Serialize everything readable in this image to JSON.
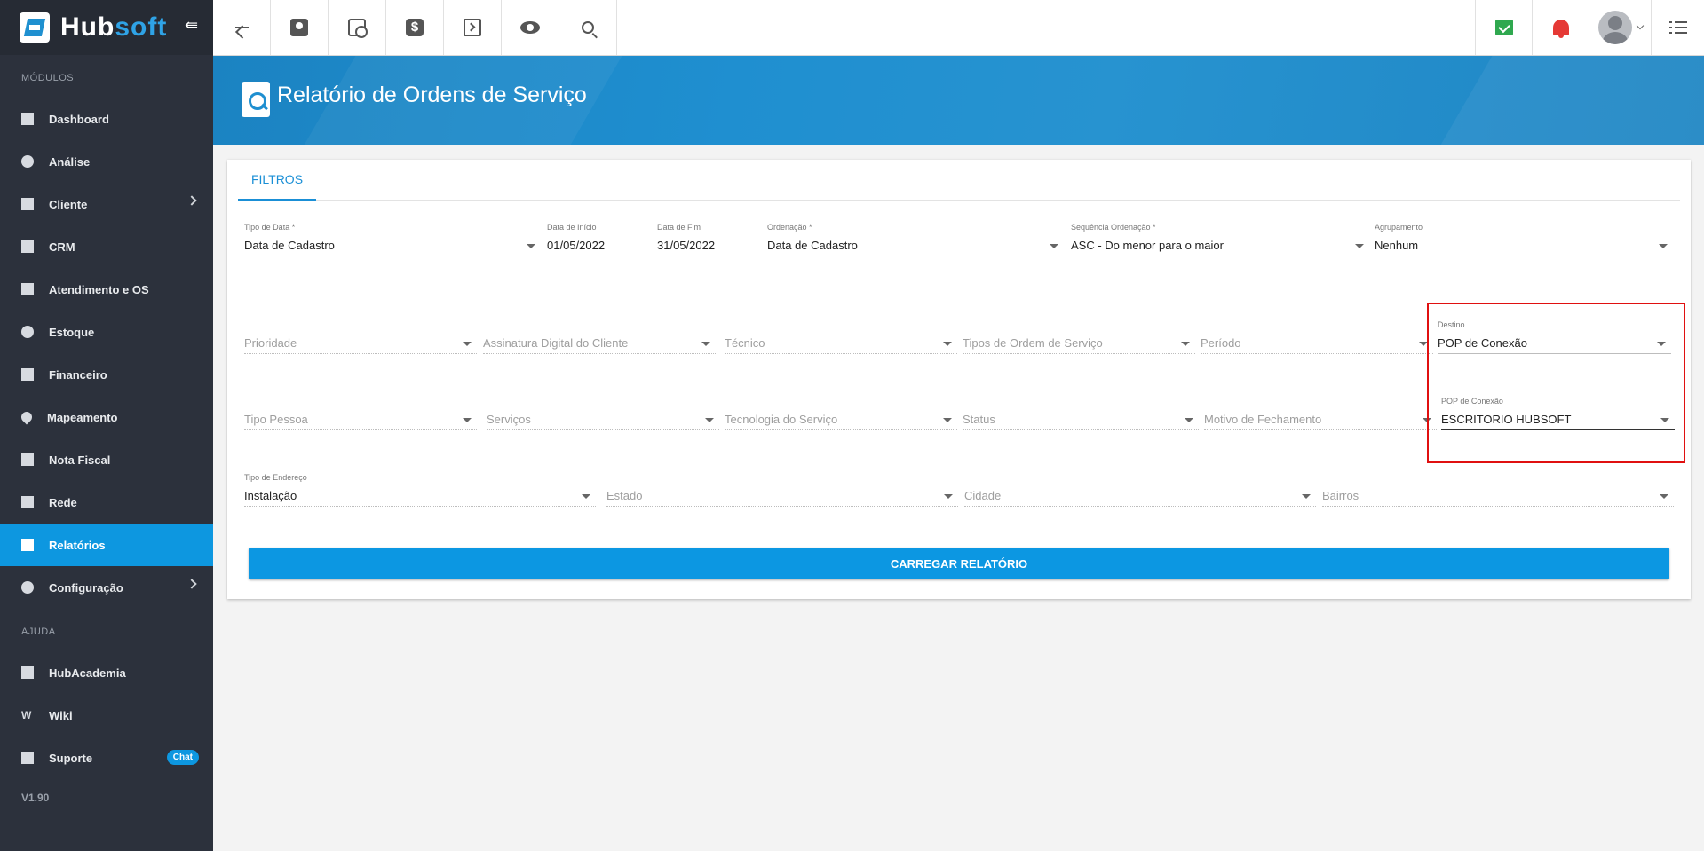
{
  "brand": {
    "part1": "Hub",
    "part2": "soft"
  },
  "sidebar": {
    "modules_label": "MÓDULOS",
    "items": [
      {
        "label": "Dashboard",
        "icon": "dashboard-icon"
      },
      {
        "label": "Análise",
        "icon": "pie-chart-icon"
      },
      {
        "label": "Cliente",
        "icon": "contact-card-icon"
      },
      {
        "label": "CRM",
        "icon": "crm-icon"
      },
      {
        "label": "Atendimento e OS",
        "icon": "calendar-clock-icon"
      },
      {
        "label": "Estoque",
        "icon": "box-icon"
      },
      {
        "label": "Financeiro",
        "icon": "money-icon"
      },
      {
        "label": "Mapeamento",
        "icon": "map-pin-icon"
      },
      {
        "label": "Nota Fiscal",
        "icon": "receipt-icon"
      },
      {
        "label": "Rede",
        "icon": "network-icon"
      },
      {
        "label": "Relatórios",
        "icon": "report-icon"
      },
      {
        "label": "Configuração",
        "icon": "gear-icon"
      }
    ],
    "help_label": "AJUDA",
    "help_items": [
      {
        "label": "HubAcademia",
        "icon": "youtube-icon"
      },
      {
        "label": "Wiki",
        "icon": "wiki-icon"
      },
      {
        "label": "Suporte",
        "icon": "chat-icon",
        "badge": "Chat"
      }
    ],
    "version": "V1.90"
  },
  "header": {
    "title": "Relatório de Ordens de Serviço"
  },
  "tabs": [
    {
      "label": "FILTROS"
    }
  ],
  "filters": {
    "tipo_data": {
      "label": "Tipo de Data *",
      "value": "Data de Cadastro"
    },
    "data_inicio": {
      "label": "Data de Início",
      "value": "01/05/2022"
    },
    "data_fim": {
      "label": "Data de Fim",
      "value": "31/05/2022"
    },
    "ordenacao": {
      "label": "Ordenação *",
      "value": "Data de Cadastro"
    },
    "sequencia": {
      "label": "Sequência Ordenação *",
      "value": "ASC - Do menor para o maior"
    },
    "agrupamento": {
      "label": "Agrupamento",
      "value": "Nenhum"
    },
    "prioridade": {
      "placeholder": "Prioridade"
    },
    "assinatura": {
      "placeholder": "Assinatura Digital do Cliente"
    },
    "tecnico": {
      "placeholder": "Técnico"
    },
    "tipos_os": {
      "placeholder": "Tipos de Ordem de Serviço"
    },
    "periodo": {
      "placeholder": "Período"
    },
    "destino": {
      "label": "Destino",
      "value": "POP de Conexão"
    },
    "tipo_pessoa": {
      "placeholder": "Tipo Pessoa"
    },
    "servicos": {
      "placeholder": "Serviços"
    },
    "tecnologia": {
      "placeholder": "Tecnologia do Serviço"
    },
    "status": {
      "placeholder": "Status"
    },
    "motivo": {
      "placeholder": "Motivo de Fechamento"
    },
    "pop": {
      "label": "POP de Conexão",
      "value": "ESCRITORIO HUBSOFT"
    },
    "tipo_endereco": {
      "label": "Tipo de Endereço",
      "value": "Instalação"
    },
    "estado": {
      "placeholder": "Estado"
    },
    "cidade": {
      "placeholder": "Cidade"
    },
    "bairros": {
      "placeholder": "Bairros"
    }
  },
  "actions": {
    "load_label": "CARREGAR RELATÓRIO"
  },
  "colors": {
    "accent": "#0d97e0",
    "sidebar": "#2c313c",
    "highlight": "#e01010"
  }
}
